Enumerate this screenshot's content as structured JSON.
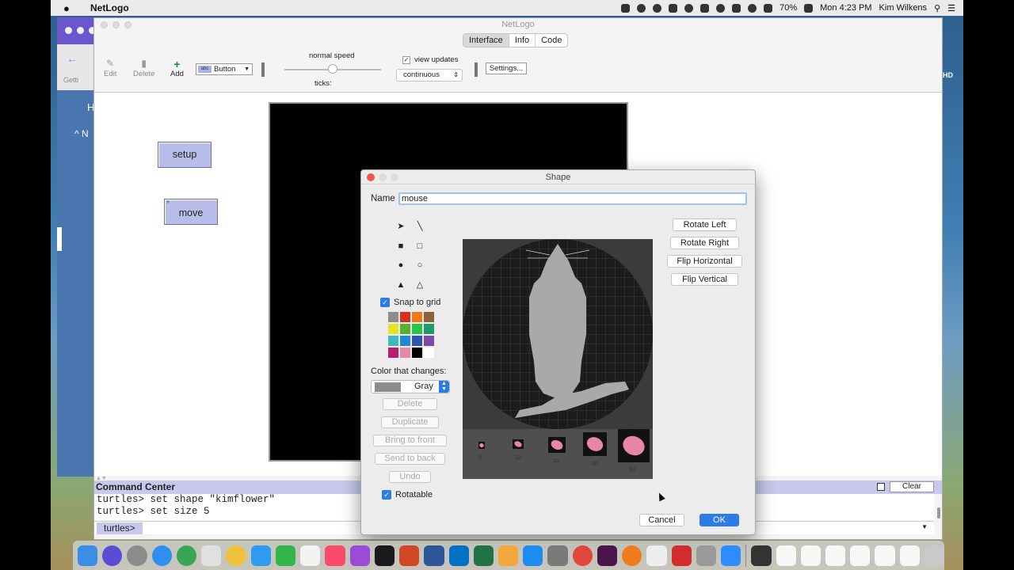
{
  "menubar": {
    "app_name": "NetLogo",
    "battery": "70%",
    "clock": "Mon 4:23 PM",
    "user": "Kim Wilkens"
  },
  "background_window": {
    "tab_text": "Getti",
    "heading_letter": "H",
    "nav_letter": "N",
    "hd_text": "HD"
  },
  "netlogo": {
    "window_title": "NetLogo",
    "tabs": [
      "Interface",
      "Info",
      "Code"
    ],
    "selected_tab": "Interface",
    "toolbar": {
      "edit": "Edit",
      "delete": "Delete",
      "add": "Add",
      "widget_type": "Button",
      "speed_label": "normal speed",
      "ticks_label": "ticks:",
      "view_updates_label": "view updates",
      "view_updates_checked": true,
      "update_mode": "continuous",
      "settings": "Settings..."
    },
    "buttons": {
      "setup": "setup",
      "move": "move"
    },
    "command_center": {
      "title": "Command Center",
      "clear": "Clear",
      "history": [
        "turtles> set shape \"kimflower\"",
        "turtles> set size 5"
      ],
      "agent_type": "turtles>"
    }
  },
  "shape_dialog": {
    "title": "Shape",
    "name_label": "Name",
    "name_value": "mouse",
    "snap_to_grid_label": "Snap to grid",
    "snap_to_grid_checked": true,
    "color_label": "Color that changes:",
    "color_value": "Gray",
    "color_chip": "#8d8d8d",
    "palette": [
      "#8d8d8d",
      "#d7301f",
      "#f07a1b",
      "#8c6239",
      "#e3e32a",
      "#58b030",
      "#27c548",
      "#1f9a6b",
      "#3fb8c0",
      "#1f8ad3",
      "#2e55b0",
      "#7b4aa6",
      "#b4206e",
      "#e887a5",
      "#000000",
      "#ffffff"
    ],
    "edit_buttons": [
      "Delete",
      "Duplicate",
      "Bring to front",
      "Send to back",
      "Undo"
    ],
    "rotatable_label": "Rotatable",
    "rotatable_checked": true,
    "transform_buttons": [
      "Rotate Left",
      "Rotate Right",
      "Flip Horizontal",
      "Flip Vertical"
    ],
    "preview_sizes": [
      "9",
      "12",
      "20",
      "30",
      "50"
    ],
    "cancel": "Cancel",
    "ok": "OK",
    "shape_color": "#a9a9a9",
    "preview_color": "#e887a5"
  }
}
